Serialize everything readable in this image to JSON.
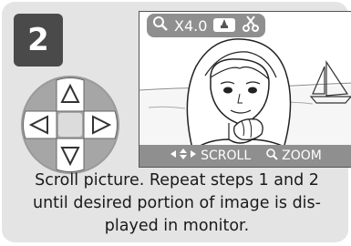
{
  "step": {
    "number": "2"
  },
  "screen": {
    "top_bar": {
      "zoom_label": "X4.0"
    },
    "bottom_bar": {
      "scroll_label": "SCROLL",
      "zoom_label": "ZOOM"
    }
  },
  "caption": {
    "lines": [
      "Scroll picture.  Repeat steps 1 and 2",
      "until desired portion of image is dis-",
      "played in monitor."
    ]
  },
  "colors": {
    "card_bg": "#e4e4e4",
    "badge_bg": "#4a4a4a",
    "bar_bg": "#8f8f8f"
  },
  "icons": [
    "magnifier-icon",
    "flash-icon",
    "scissors-icon",
    "dpad-icon",
    "scroll-arrows-icon"
  ]
}
